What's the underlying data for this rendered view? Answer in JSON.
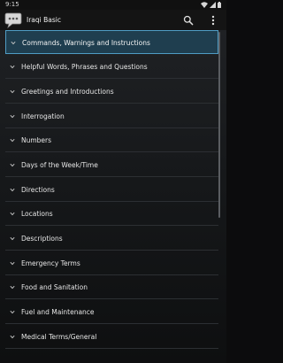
{
  "status_bar": {
    "time": "9:15",
    "icons": [
      "wifi-icon",
      "signal-icon",
      "battery-icon"
    ]
  },
  "app_bar": {
    "title": "Iraqi Basic",
    "icons": [
      "chat-bubble-app-icon",
      "search-icon",
      "more-vert-icon"
    ]
  },
  "colors": {
    "accent_border": "#4f9cc4",
    "selected_background": "#1f3e4f"
  },
  "list": {
    "items": [
      {
        "label": "Commands, Warnings and Instructions",
        "selected": true
      },
      {
        "label": "Helpful Words, Phrases and Questions"
      },
      {
        "label": "Greetings and Introductions"
      },
      {
        "label": "Interrogation"
      },
      {
        "label": "Numbers"
      },
      {
        "label": "Days of the Week/Time"
      },
      {
        "label": "Directions"
      },
      {
        "label": "Locations"
      },
      {
        "label": "Descriptions"
      },
      {
        "label": "Emergency Terms"
      },
      {
        "label": "Food and Sanitation"
      },
      {
        "label": "Fuel and Maintenance"
      },
      {
        "label": "Medical Terms/General"
      }
    ]
  }
}
